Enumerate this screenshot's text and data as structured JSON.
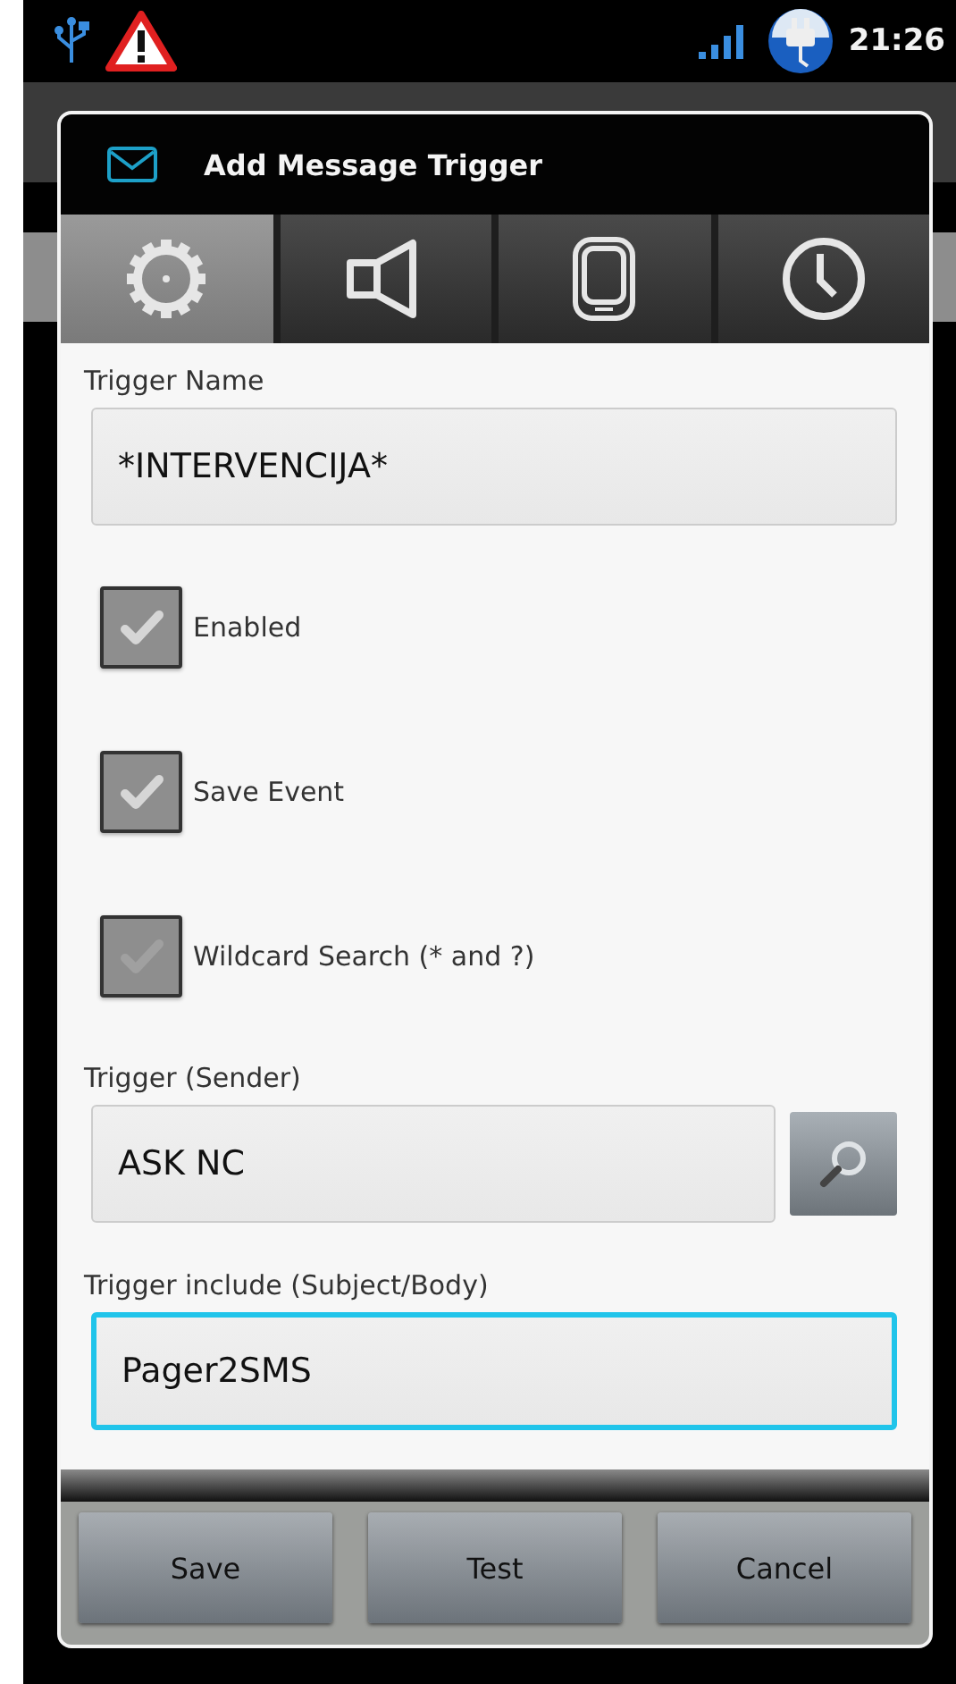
{
  "status_bar": {
    "time": "21:26"
  },
  "dialog": {
    "title": "Add Message Trigger",
    "tabs": [
      {
        "kind": "gear",
        "selected": true
      },
      {
        "kind": "speaker",
        "selected": false
      },
      {
        "kind": "phone",
        "selected": false
      },
      {
        "kind": "clock",
        "selected": false
      }
    ],
    "trigger_name": {
      "label": "Trigger Name",
      "value": "*INTERVENCIJA*"
    },
    "checkboxes": [
      {
        "label": "Enabled",
        "checked": true,
        "disabled": false
      },
      {
        "label": "Save Event",
        "checked": true,
        "disabled": false
      },
      {
        "label": "Wildcard Search (* and ?)",
        "checked": true,
        "disabled": true
      }
    ],
    "trigger_sender": {
      "label": "Trigger (Sender)",
      "value": "ASK NC"
    },
    "trigger_include": {
      "label": "Trigger include (Subject/Body)",
      "value": "Pager2SMS",
      "focused": true
    },
    "buttons": [
      "Save",
      "Test",
      "Cancel"
    ]
  }
}
